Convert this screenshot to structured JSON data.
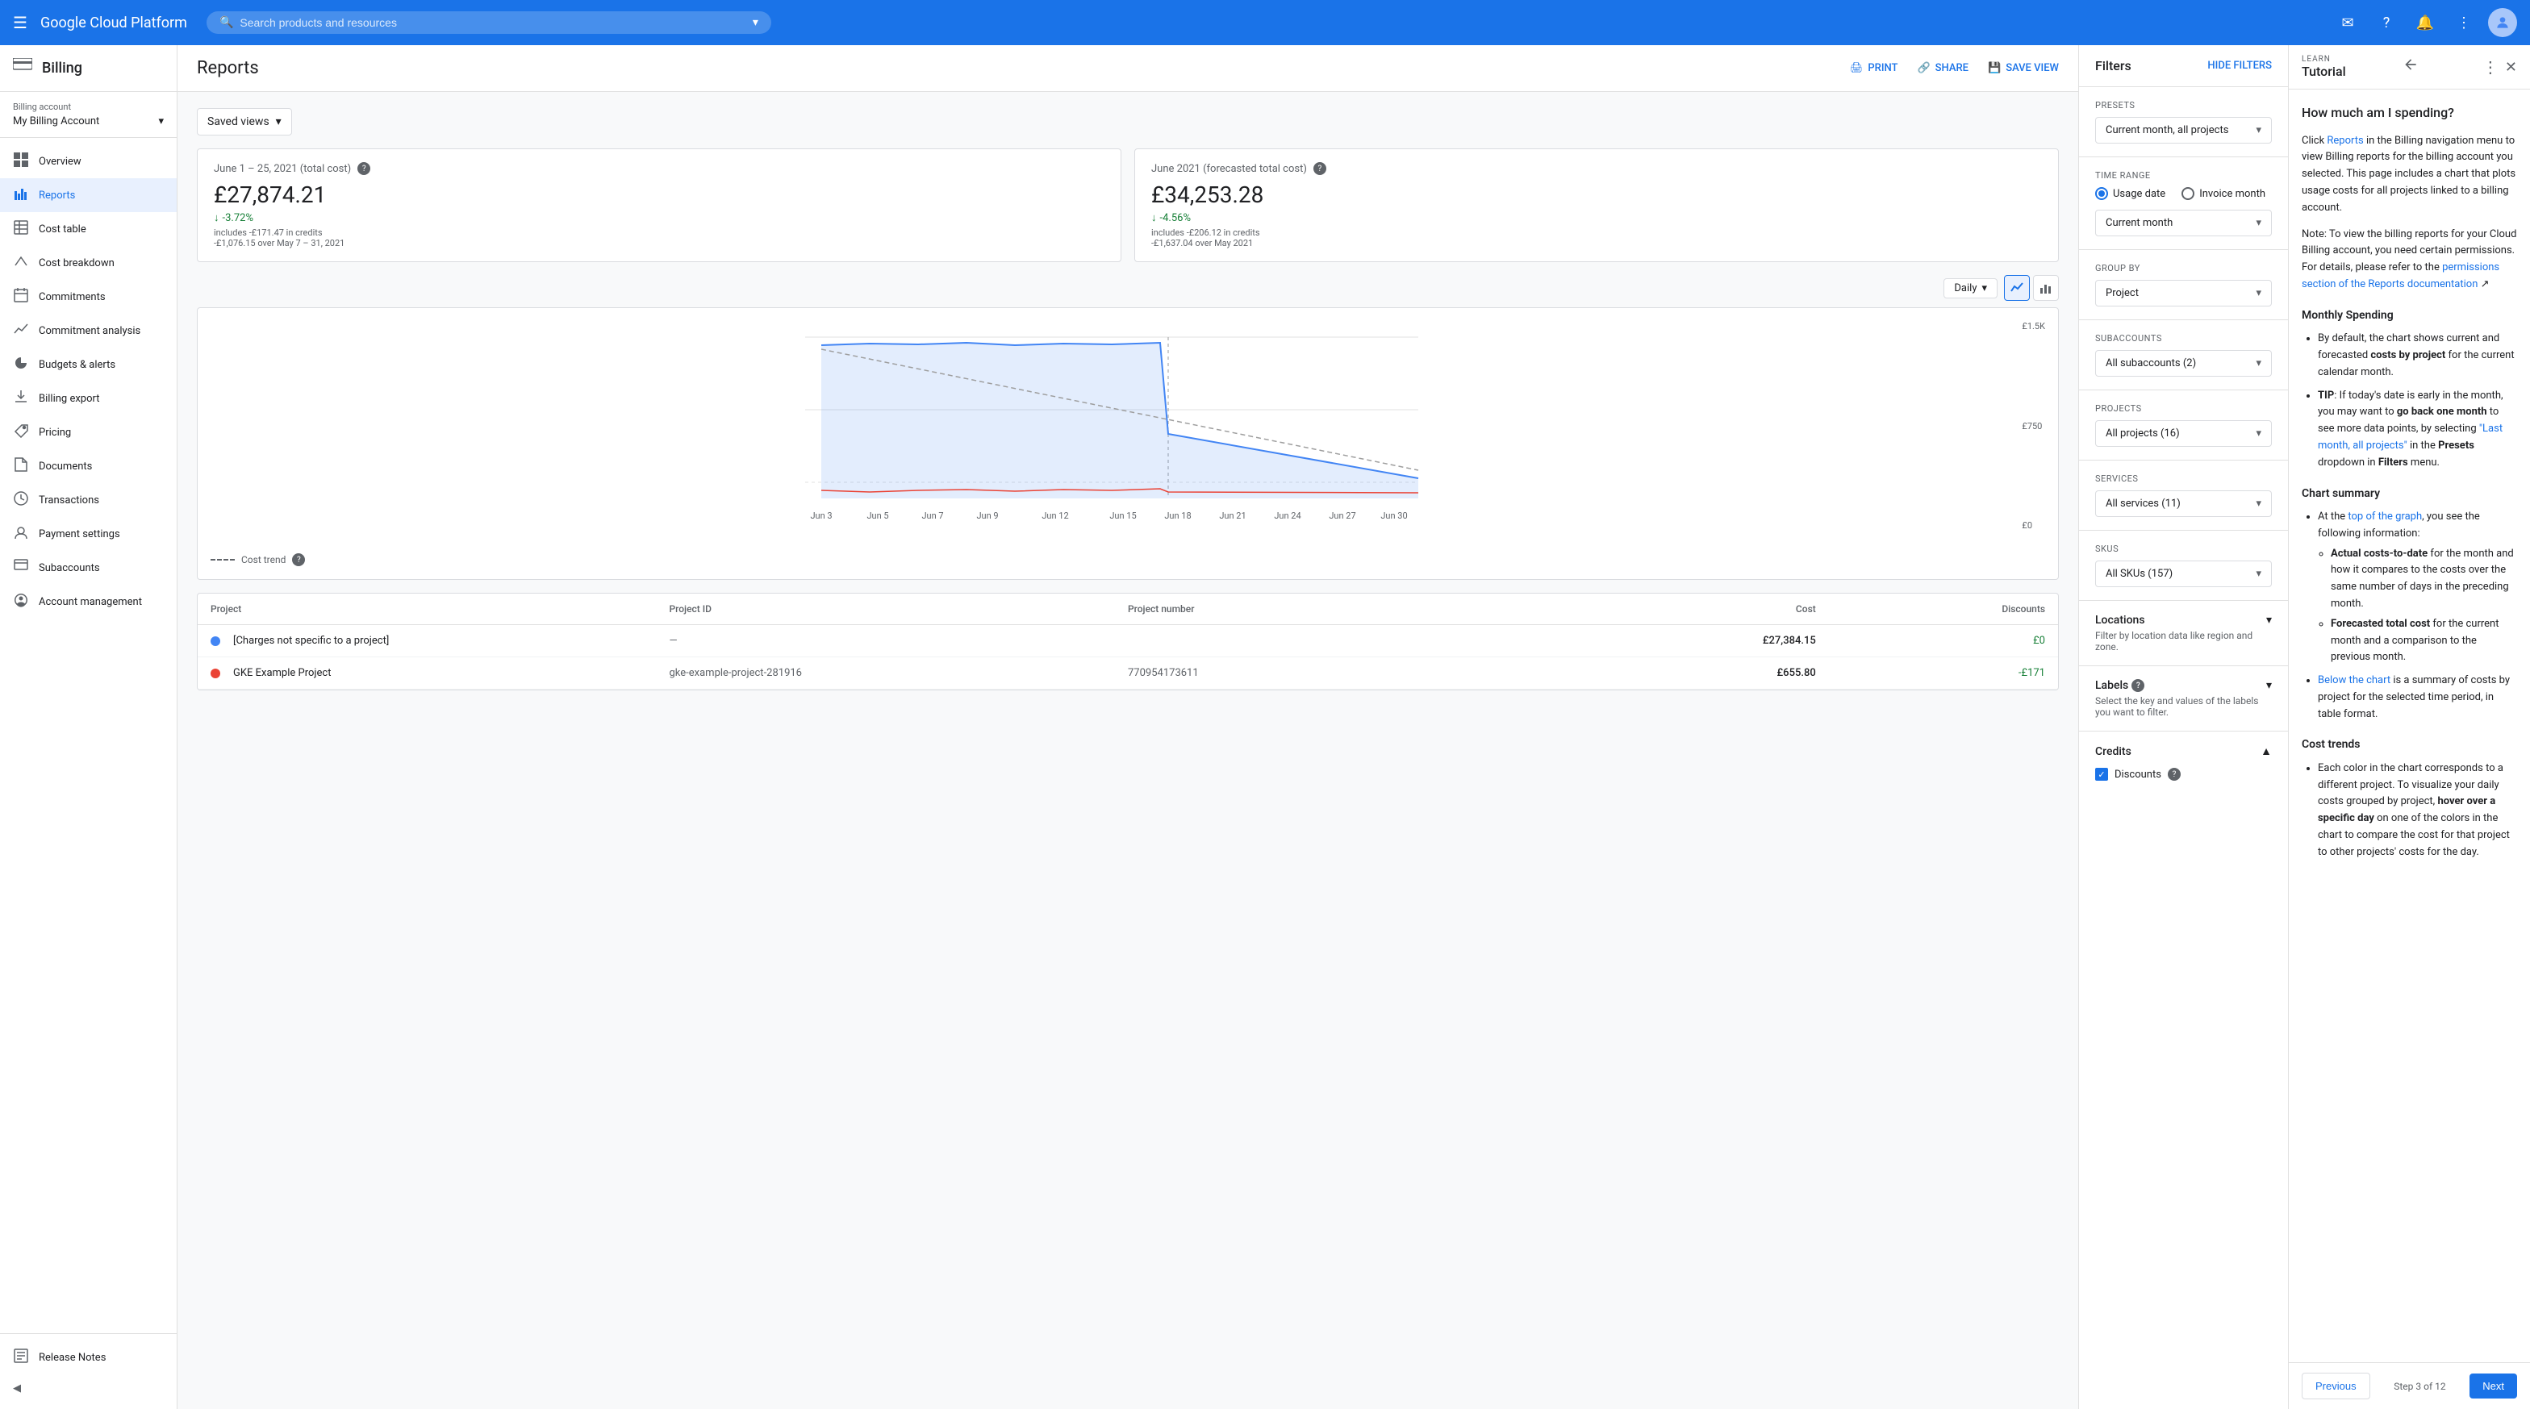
{
  "topnav": {
    "logo": "Google Cloud Platform",
    "search_placeholder": "Search products and resources",
    "hamburger_label": "☰"
  },
  "sidebar": {
    "title": "Billing",
    "billing_account_label": "Billing account",
    "billing_account_name": "My Billing Account",
    "nav_items": [
      {
        "id": "overview",
        "label": "Overview",
        "icon": "⊞"
      },
      {
        "id": "reports",
        "label": "Reports",
        "icon": "📊",
        "active": true
      },
      {
        "id": "cost-table",
        "label": "Cost table",
        "icon": "⊟"
      },
      {
        "id": "cost-breakdown",
        "label": "Cost breakdown",
        "icon": "📉"
      },
      {
        "id": "commitments",
        "label": "Commitments",
        "icon": "📋"
      },
      {
        "id": "commitment-analysis",
        "label": "Commitment analysis",
        "icon": "📈"
      },
      {
        "id": "budgets-alerts",
        "label": "Budgets & alerts",
        "icon": "🔔"
      },
      {
        "id": "billing-export",
        "label": "Billing export",
        "icon": "⬆"
      },
      {
        "id": "pricing",
        "label": "Pricing",
        "icon": "🏷"
      },
      {
        "id": "documents",
        "label": "Documents",
        "icon": "📄"
      },
      {
        "id": "transactions",
        "label": "Transactions",
        "icon": "🕐"
      },
      {
        "id": "payment-settings",
        "label": "Payment settings",
        "icon": "👤"
      },
      {
        "id": "subaccounts",
        "label": "Subaccounts",
        "icon": "📁"
      },
      {
        "id": "account-management",
        "label": "Account management",
        "icon": "⚙"
      }
    ],
    "footer_items": [
      {
        "id": "release-notes",
        "label": "Release Notes",
        "icon": "📝"
      }
    ],
    "collapse_label": "◀"
  },
  "reports": {
    "title": "Reports",
    "actions": [
      {
        "id": "print",
        "label": "PRINT",
        "icon": "🖨"
      },
      {
        "id": "share",
        "label": "SHARE",
        "icon": "🔗"
      },
      {
        "id": "save-view",
        "label": "SAVE VIEW",
        "icon": "💾"
      }
    ],
    "saved_views_label": "Saved views",
    "stat_cards": [
      {
        "id": "actual",
        "period": "June 1 – 25, 2021 (total cost)",
        "help": "?",
        "amount": "£27,874.21",
        "change": "-3.72%",
        "change_direction": "down",
        "subtitle1": "includes -£171.47 in credits",
        "subtitle2": "-£1,076.15 over May 7 – 31, 2021"
      },
      {
        "id": "forecasted",
        "period": "June 2021 (forecasted total cost)",
        "help": "?",
        "amount": "£34,253.28",
        "change": "-4.56%",
        "change_direction": "down",
        "subtitle1": "includes -£206.12 in credits",
        "subtitle2": "-£1,637.04 over May 2021"
      }
    ],
    "chart": {
      "view_type": "Daily",
      "y_labels": [
        "£1.5K",
        "£750",
        "£0"
      ],
      "x_labels": [
        "Jun 3",
        "Jun 5",
        "Jun 7",
        "Jun 9",
        "Jun 12",
        "Jun 15",
        "Jun 18",
        "Jun 21",
        "Jun 24",
        "Jun 27",
        "Jun 30"
      ],
      "cost_trend_label": "Cost trend",
      "cost_trend_help": "?"
    },
    "table": {
      "columns": [
        "Project",
        "Project ID",
        "Project number",
        "Cost",
        "Discounts"
      ],
      "rows": [
        {
          "color": "#4285f4",
          "name": "[Charges not specific to a project]",
          "id": "—",
          "number": "",
          "cost": "£27,384.15",
          "discount": "£0"
        },
        {
          "color": "#ea4335",
          "name": "GKE Example Project",
          "id": "gke-example-project-281916",
          "number": "770954173611",
          "cost": "£655.80",
          "discount": "-£171"
        }
      ]
    }
  },
  "filters": {
    "title": "Filters",
    "hide_label": "HIDE FILTERS",
    "presets": {
      "label": "Presets",
      "value": "Current month, all projects"
    },
    "time_range": {
      "label": "Time range",
      "radio_options": [
        {
          "id": "usage-date",
          "label": "Usage date",
          "selected": true
        },
        {
          "id": "invoice-month",
          "label": "Invoice month",
          "selected": false
        }
      ],
      "select_value": "Current month"
    },
    "group_by": {
      "label": "Group by",
      "value": "Project"
    },
    "subaccounts": {
      "label": "Subaccounts",
      "value": "All subaccounts (2)"
    },
    "projects": {
      "label": "Projects",
      "value": "All projects (16)"
    },
    "services": {
      "label": "Services",
      "value": "All services (11)"
    },
    "skus": {
      "label": "SKUs",
      "value": "All SKUs (157)"
    },
    "locations": {
      "label": "Locations",
      "description": "Filter by location data like region and zone."
    },
    "labels": {
      "label": "Labels",
      "description": "Select the key and values of the labels you want to filter."
    },
    "credits": {
      "label": "Credits",
      "discounts_label": "Discounts"
    }
  },
  "tutorial": {
    "learn_label": "LEARN",
    "title": "Tutorial",
    "heading": "How much am I spending?",
    "body_parts": [
      {
        "type": "text",
        "text": "Click "
      },
      {
        "type": "link",
        "text": "Reports"
      },
      {
        "type": "text",
        "text": " in the Billing navigation menu to view Billing reports for the billing account you selected. This page includes a chart that plots usage costs for all projects linked to a billing account."
      }
    ],
    "note": "Note: To view the billing reports for your Cloud Billing account, you need certain permissions. For details, please refer to the",
    "note_link": "permissions section of the Reports documentation",
    "sections": [
      {
        "title": "Monthly Spending",
        "items": [
          "By default, the chart shows current and forecasted costs by project for the current calendar month.",
          "TIP: If today's date is early in the month, you may want to go back one month to see more data points, by selecting \"Last month, all projects\" in the Presets dropdown in Filters menu."
        ]
      },
      {
        "title": "Chart summary",
        "items": [
          "At the top of the graph, you see the following information:",
          [
            "Actual costs-to-date for the month and how it compares to the costs over the same number of days in the preceding month.",
            "Forecasted total cost for the current month and a comparison to the previous month."
          ],
          "Below the chart is a summary of costs by project for the selected time period, in table format."
        ]
      },
      {
        "title": "Cost trends",
        "items": [
          "Each color in the chart corresponds to a different project. To visualize your daily costs grouped by project, hover over a specific day on one of the colors in the chart to compare the cost for that project to other projects' costs for the day."
        ]
      }
    ],
    "footer": {
      "prev_label": "Previous",
      "step_label": "Step 3 of 12",
      "next_label": "Next"
    }
  }
}
